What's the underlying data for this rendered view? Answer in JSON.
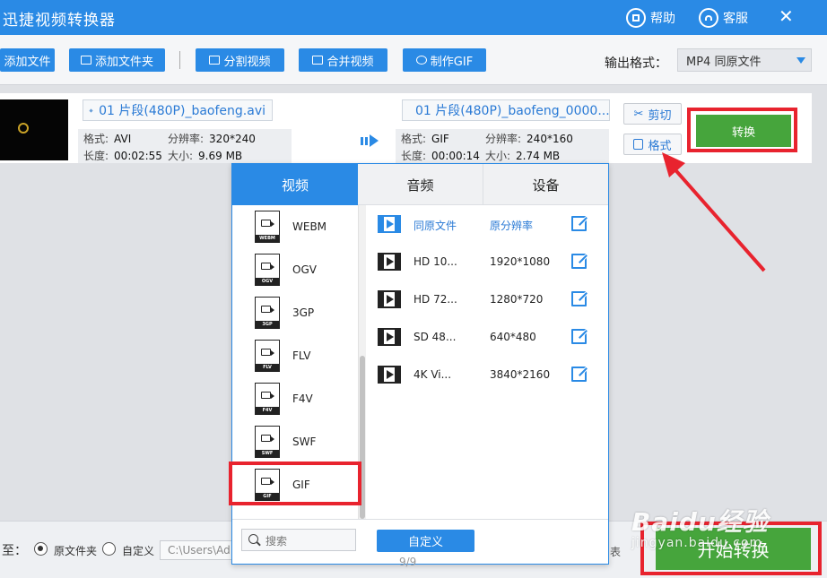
{
  "app": {
    "title": "迅捷视频转换器",
    "help_label": "帮助",
    "service_label": "客服"
  },
  "toolbar": {
    "add_file": "添加文件",
    "add_folder": "添加文件夹",
    "split_video": "分割视频",
    "merge_video": "合并视频",
    "make_gif": "制作GIF",
    "output_format_label": "输出格式：",
    "output_format_value": "MP4  同原文件"
  },
  "file": {
    "source_name": "01 片段(480P)_baofeng.avi",
    "source": {
      "format_key": "格式:",
      "format": "AVI",
      "resolution_key": "分辨率:",
      "resolution": "320*240",
      "duration_key": "长度:",
      "duration": "00:02:55",
      "size_key": "大小:",
      "size": "9.69 MB"
    },
    "target_name": "01 片段(480P)_baofeng_0000...",
    "target": {
      "format_key": "格式:",
      "format": "GIF",
      "resolution_key": "分辨率:",
      "resolution": "240*160",
      "duration_key": "长度:",
      "duration": "00:00:14",
      "size_key": "大小:",
      "size": "2.74 MB"
    },
    "cut_label": "剪切",
    "format_label": "格式",
    "convert_label": "转换"
  },
  "popup": {
    "tabs": [
      "视频",
      "音频",
      "设备"
    ],
    "formats": [
      {
        "name": "WEBM",
        "tag": "WEBM"
      },
      {
        "name": "OGV",
        "tag": "OGV"
      },
      {
        "name": "3GP",
        "tag": "3GP"
      },
      {
        "name": "FLV",
        "tag": "FLV"
      },
      {
        "name": "F4V",
        "tag": "F4V"
      },
      {
        "name": "SWF",
        "tag": "SWF"
      },
      {
        "name": "GIF",
        "tag": "GIF"
      }
    ],
    "selected_format": "GIF",
    "presets": [
      {
        "name": "同原文件",
        "res": "原分辨率"
      },
      {
        "name": "HD 10...",
        "res": "1920*1080"
      },
      {
        "name": "HD 72...",
        "res": "1280*720"
      },
      {
        "name": "SD 48...",
        "res": "640*480"
      },
      {
        "name": "4K Vi...",
        "res": "3840*2160"
      }
    ],
    "search_placeholder": "搜索",
    "custom_label": "自定义",
    "page": "9/9"
  },
  "bottom": {
    "output_to": "至：",
    "original_folder": "原文件夹",
    "custom": "自定义",
    "path": "C:\\Users\\Ad",
    "partial_text": "表",
    "start_label": "开始转换"
  },
  "watermark": {
    "main": "Baidu经验",
    "sub": "jingyan.baidu.com"
  },
  "colors": {
    "accent": "#2a8ae5",
    "highlight_red": "#e8232e",
    "convert_green": "#46a53c"
  }
}
